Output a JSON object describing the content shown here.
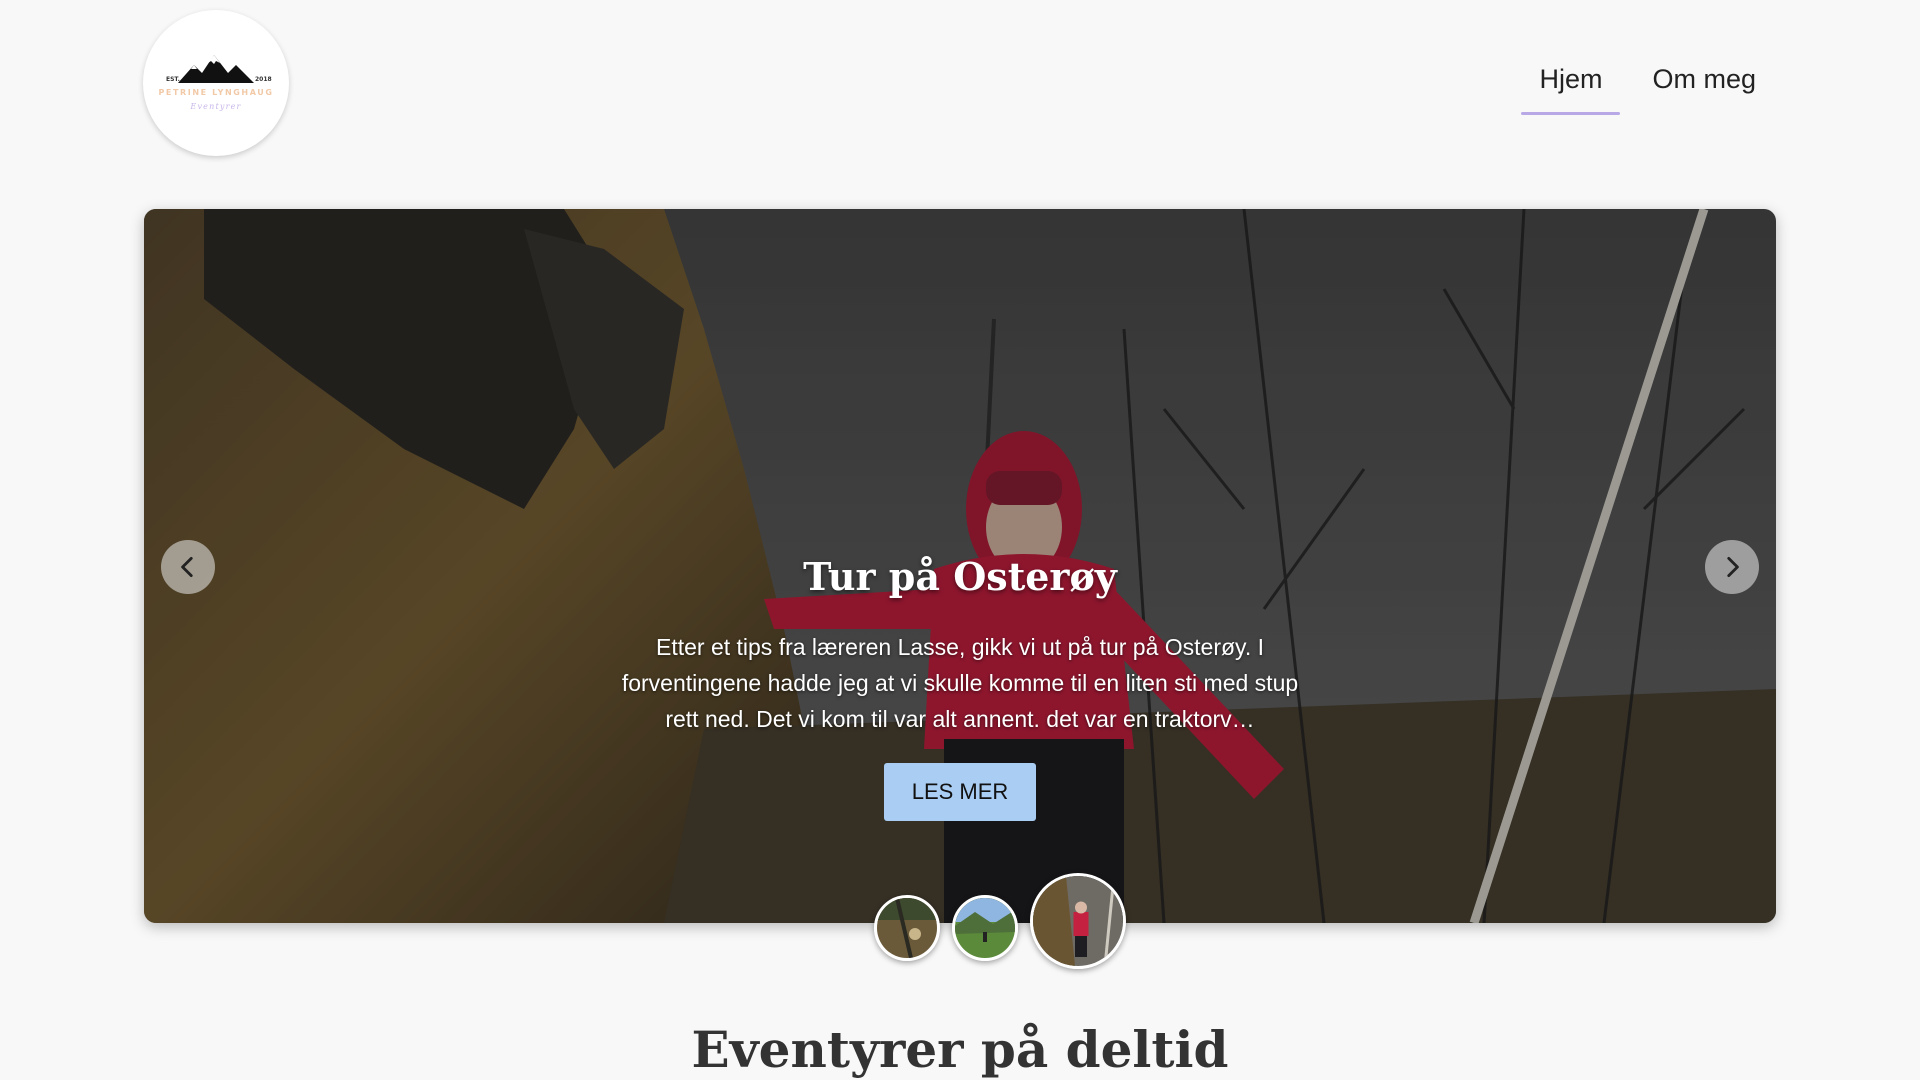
{
  "logo": {
    "est_left": "EST.",
    "est_right": "2018",
    "brand": "PETRINE LYNGHAUG",
    "tagline": "Eventyrer"
  },
  "nav": {
    "items": [
      {
        "label": "Hjem",
        "active": true
      },
      {
        "label": "Om meg",
        "active": false
      }
    ],
    "active_underline_color": "#b9a8e6"
  },
  "hero": {
    "title": "Tur på Osterøy",
    "text": "Etter et tips fra læreren Lasse, gikk vi ut på tur på Osterøy. I forventingene hadde jeg at vi skulle komme til en liten sti med stup rett ned. Det vi kom til var alt annent. det var en traktorv…",
    "button_label": "LES MER",
    "button_color": "#a9cdf3",
    "prev_icon": "chevron-left-icon",
    "next_icon": "chevron-right-icon"
  },
  "thumbnails": {
    "count": 3,
    "active_index": 2
  },
  "section": {
    "title": "Eventyrer på deltid"
  }
}
